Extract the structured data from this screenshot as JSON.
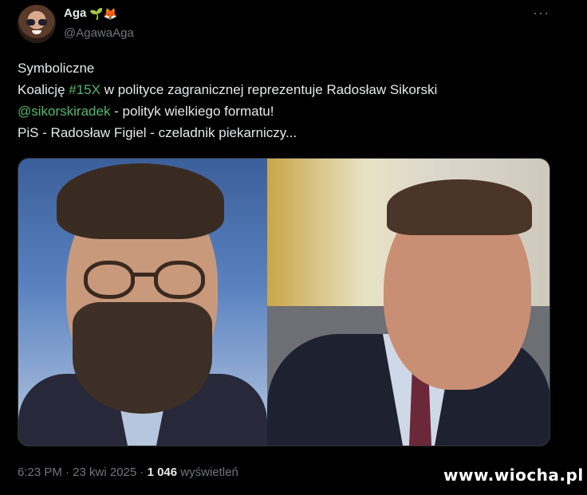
{
  "author": {
    "display_name": "Aga",
    "emojis": "🌱🦊",
    "handle": "@AgawaAga"
  },
  "more_icon": "more-horizontal-icon",
  "tweet": {
    "line1": "Symboliczne",
    "line2_before": "Koalicję ",
    "line2_hashtag": "#15X",
    "line2_after": " w polityce zagranicznej reprezentuje Radosław Sikorski",
    "line3_mention": "@sikorskiradek",
    "line3_after": " - polityk wielkiego formatu!",
    "line4": "PiS - Radosław Figiel - czeladnik piekarniczy..."
  },
  "meta": {
    "time_date": "6:23 PM · 23 kwi 2025 · ",
    "views_count": "1 046",
    "views_label": " wyświetleń"
  },
  "watermark": "www.wiocha.pl",
  "colors": {
    "background": "#000000",
    "hashtag": "#1d9bf0",
    "mention": "#4fb96e",
    "secondary_text": "#71767b"
  }
}
